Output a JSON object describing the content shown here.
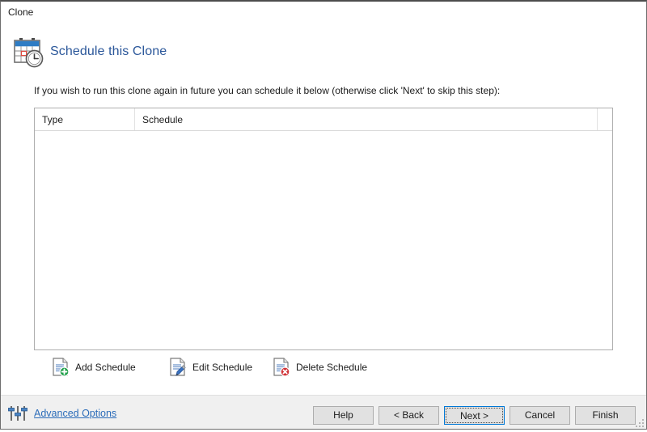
{
  "window": {
    "title": "Clone"
  },
  "header": {
    "icon": "calendar-clock-icon",
    "title": "Schedule this Clone"
  },
  "instruction": "If you wish to run this clone again in future you can schedule it below (otherwise click 'Next' to skip this step):",
  "schedule_list": {
    "columns": [
      {
        "label": "Type"
      },
      {
        "label": "Schedule"
      },
      {
        "label": ""
      }
    ],
    "rows": []
  },
  "actions": [
    {
      "label": "Add Schedule",
      "icon": "document-add-icon"
    },
    {
      "label": "Edit Schedule",
      "icon": "document-edit-icon"
    },
    {
      "label": "Delete Schedule",
      "icon": "document-delete-icon"
    }
  ],
  "footer": {
    "advanced_options": {
      "label": "Advanced Options",
      "icon": "sliders-icon"
    },
    "buttons": {
      "help": "Help",
      "back": "< Back",
      "next": "Next >",
      "cancel": "Cancel",
      "finish": "Finish"
    }
  },
  "colors": {
    "accent_blue": "#2b579a",
    "link_blue": "#2b6cb9",
    "focus_blue": "#0078d7",
    "add_green": "#21a04a",
    "edit_blue": "#3a74c4",
    "delete_red": "#d13438",
    "window_bg": "#ffffff",
    "footer_bg": "#f0f0f0"
  }
}
